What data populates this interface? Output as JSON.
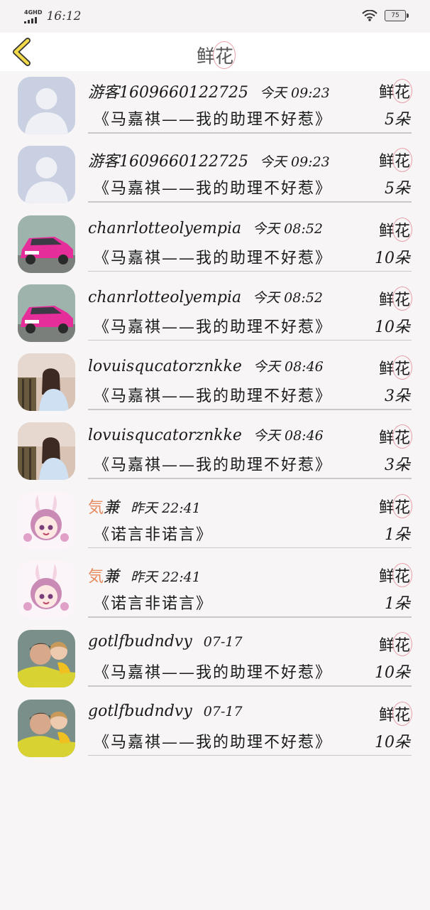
{
  "status_bar": {
    "network": "4GHD",
    "time": "16:12",
    "battery": "75"
  },
  "header": {
    "title_part1": "鲜",
    "title_part2": "花"
  },
  "flower_label_part1": "鲜",
  "flower_label_part2": "花",
  "rows": [
    {
      "user": "游客1609660122725",
      "time": "今天 09:23",
      "book": "《马嘉祺——我的助理不好惹》",
      "count": "5朵",
      "avatar": "default"
    },
    {
      "user": "游客1609660122725",
      "time": "今天 09:23",
      "book": "《马嘉祺——我的助理不好惹》",
      "count": "5朵",
      "avatar": "default"
    },
    {
      "user": "chanrlotteolyempia",
      "time": "今天 08:52",
      "book": "《马嘉祺——我的助理不好惹》",
      "count": "10朵",
      "avatar": "pink-car"
    },
    {
      "user": "chanrlotteolyempia",
      "time": "今天 08:52",
      "book": "《马嘉祺——我的助理不好惹》",
      "count": "10朵",
      "avatar": "pink-car"
    },
    {
      "user": "lovuisqucatorznkke",
      "time": "今天 08:46",
      "book": "《马嘉祺——我的助理不好惹》",
      "count": "3朵",
      "avatar": "girl-flowers"
    },
    {
      "user": "lovuisqucatorznkke",
      "time": "今天 08:46",
      "book": "《马嘉祺——我的助理不好惹》",
      "count": "3朵",
      "avatar": "girl-flowers"
    },
    {
      "user_a": "気",
      "user_b": "兼",
      "time": "昨天 22:41",
      "book": "《诺言非诺言》",
      "count": "1朵",
      "avatar": "anime-bunny"
    },
    {
      "user_a": "気",
      "user_b": "兼",
      "time": "昨天 22:41",
      "book": "《诺言非诺言》",
      "count": "1朵",
      "avatar": "anime-bunny"
    },
    {
      "user": "gotlfbudndvy",
      "time": "07-17",
      "book": "《马嘉祺——我的助理不好惹》",
      "count": "10朵",
      "avatar": "man-child"
    },
    {
      "user": "gotlfbudndvy",
      "time": "07-17",
      "book": "《马嘉祺——我的助理不好惹》",
      "count": "10朵",
      "avatar": "man-child"
    }
  ],
  "colors": {
    "background": "#f7f5f6",
    "accent_orange": "#e78a5e",
    "back_arrow": "#f2d94a"
  }
}
